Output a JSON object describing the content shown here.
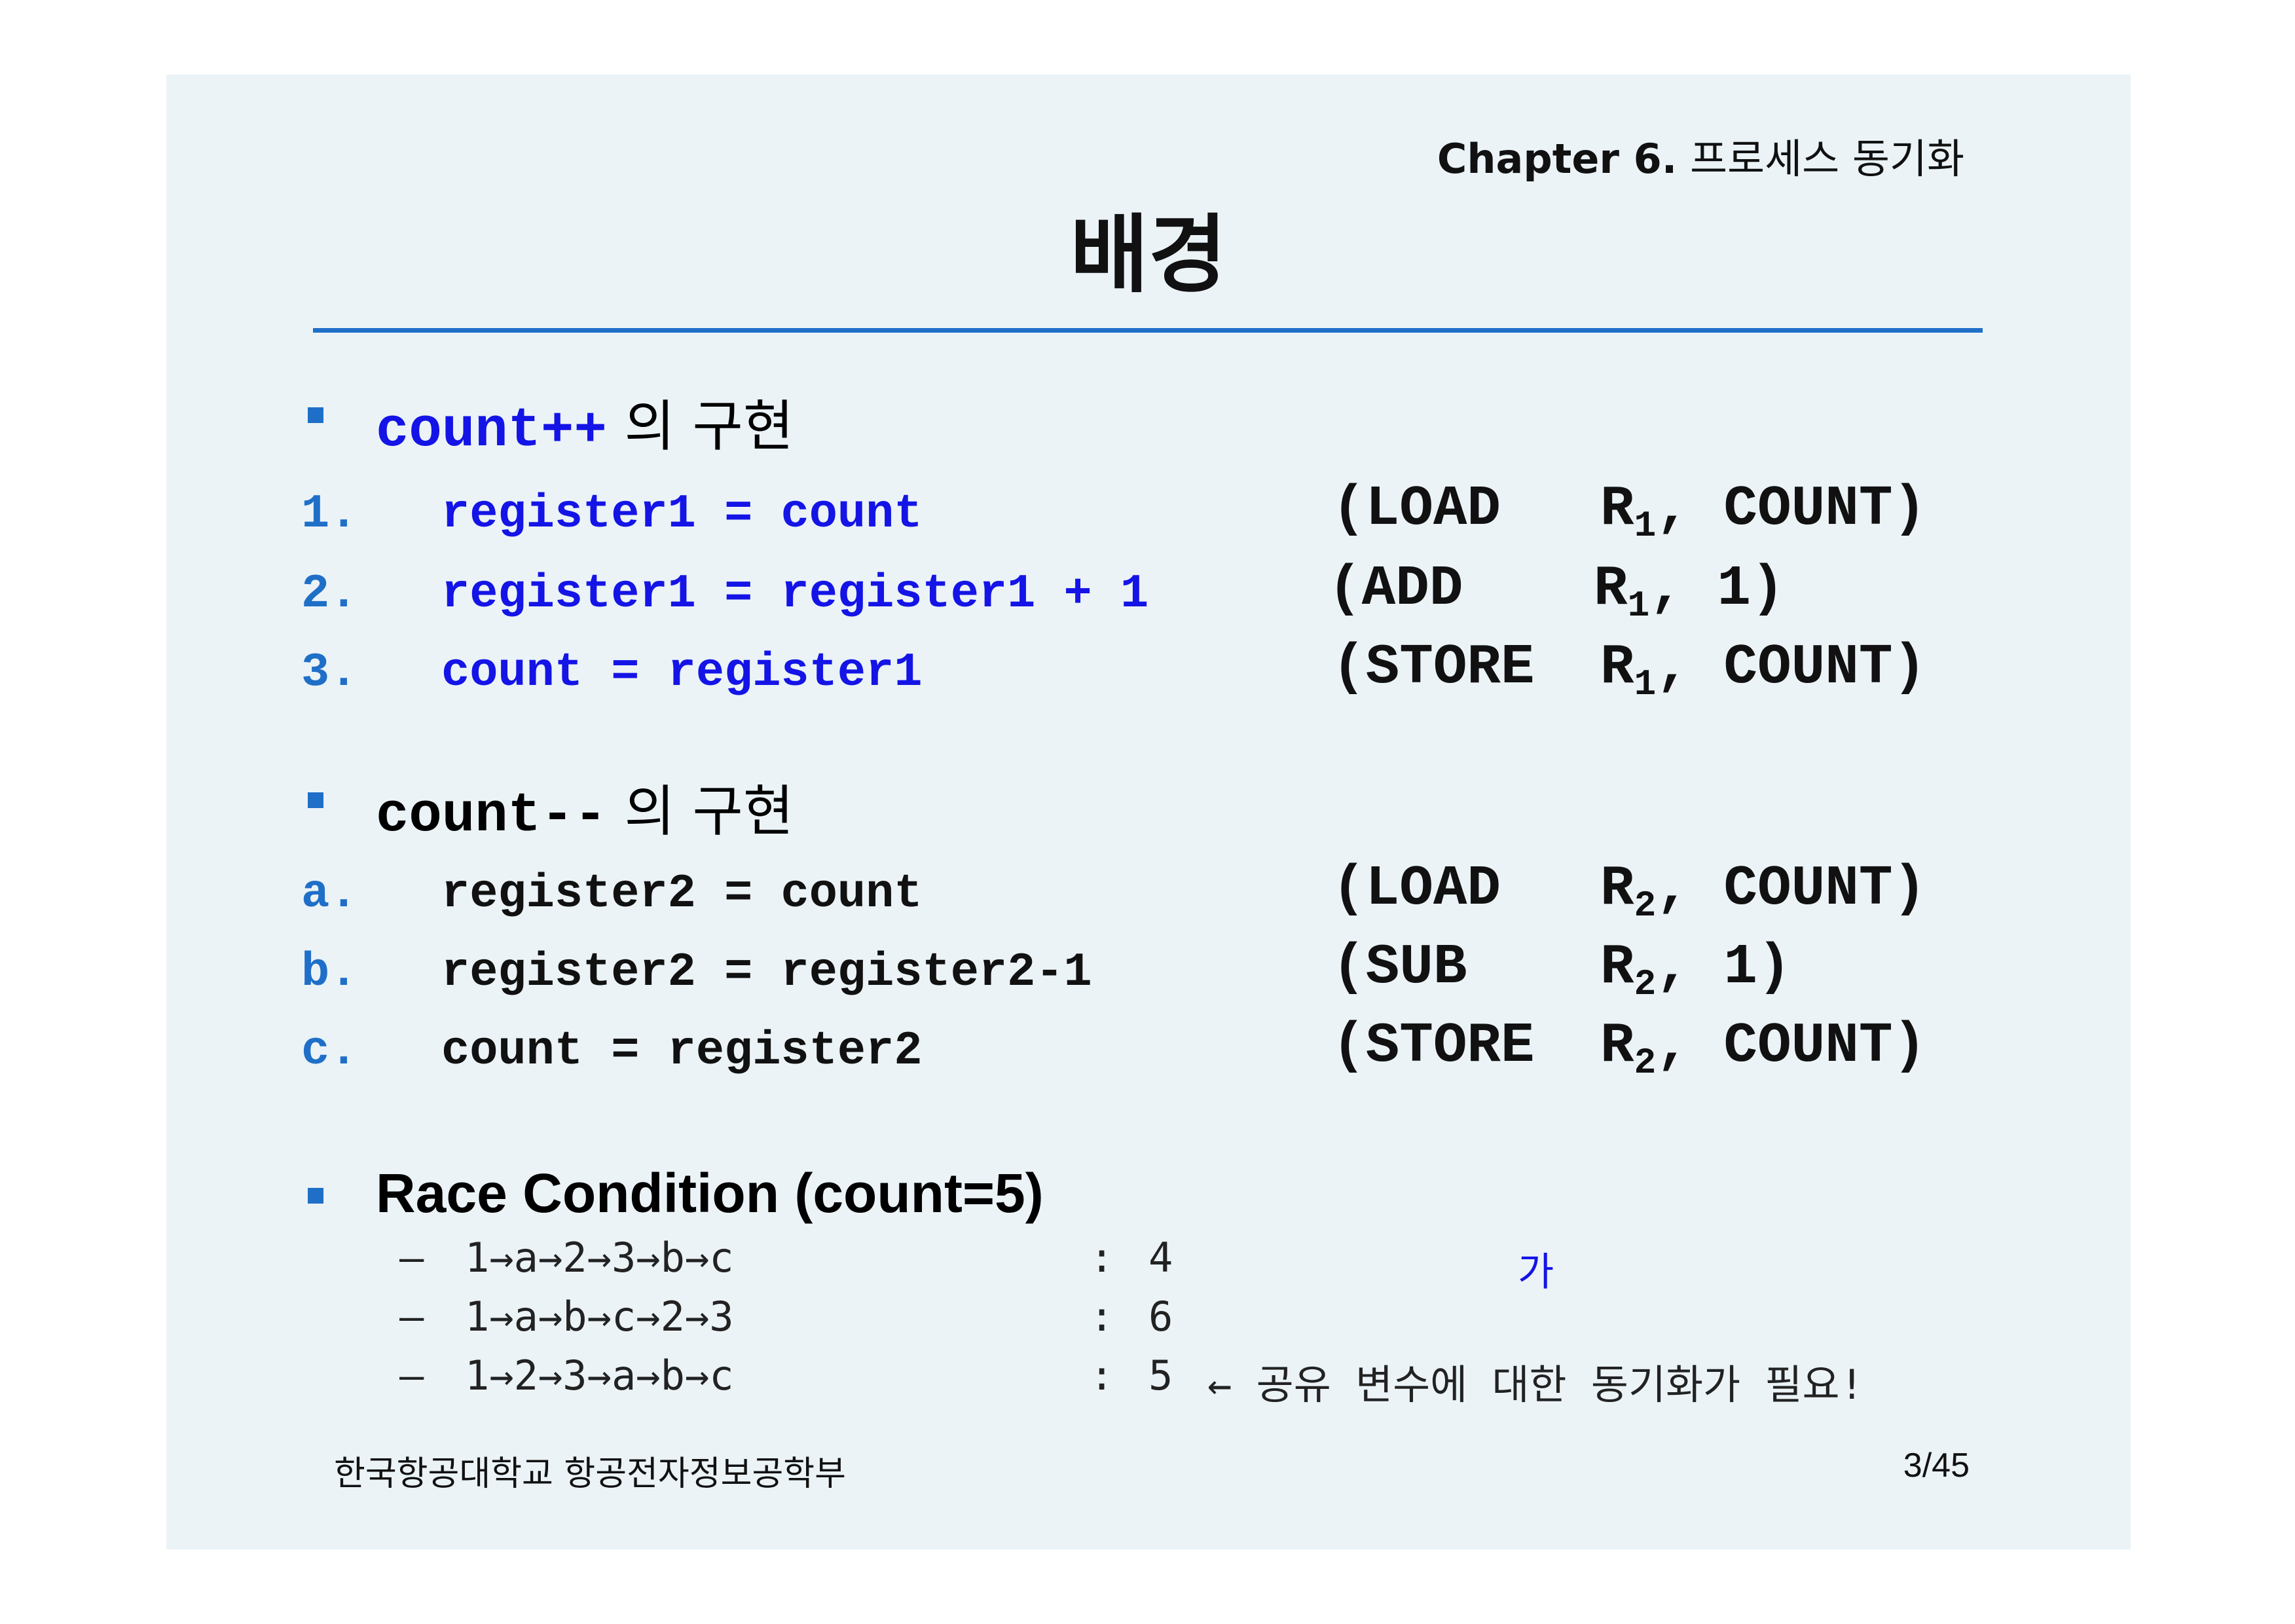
{
  "header": {
    "chapter_label": "Chapter 6.",
    "chapter_title": "프로세스 동기화",
    "slide_title": "배경"
  },
  "section_increment": {
    "code_part": "count++",
    "korean_part": " 의 구현",
    "steps": [
      {
        "num": "1.",
        "code": "register1 = count",
        "op": "(LOAD",
        "reg": "R",
        "sub": "1",
        "arg": ", COUNT)"
      },
      {
        "num": "2.",
        "code": "register1 = register1 + 1",
        "op": "(ADD",
        "reg": "R",
        "sub": "1",
        "arg": ", 1)"
      },
      {
        "num": "3.",
        "code": "count = register1",
        "op": "(STORE",
        "reg": "R",
        "sub": "1",
        "arg": ", COUNT)"
      }
    ]
  },
  "section_decrement": {
    "code_part": "count--",
    "korean_part": " 의 구현",
    "steps": [
      {
        "num": "a.",
        "code": "register2 = count",
        "op": "(LOAD",
        "reg": "R",
        "sub": "2",
        "arg": ", COUNT)"
      },
      {
        "num": "b.",
        "code": "register2 = register2-1",
        "op": "(SUB",
        "reg": "R",
        "sub": "2",
        "arg": ", 1)"
      },
      {
        "num": "c.",
        "code": "count = register2",
        "op": "(STORE",
        "reg": "R",
        "sub": "2",
        "arg": ", COUNT)"
      }
    ]
  },
  "section_race": {
    "heading": "Race Condition (count=5)",
    "blue_note": "가",
    "orders": [
      {
        "dash": "–",
        "sequence": "1→a→2→3→b→c",
        "colon": ":",
        "result": "4",
        "note": ""
      },
      {
        "dash": "–",
        "sequence": "1→a→b→c→2→3",
        "colon": ":",
        "result": "6",
        "note": ""
      },
      {
        "dash": "–",
        "sequence": "1→2→3→a→b→c",
        "colon": ":",
        "result": "5",
        "note": "← 공유 변수에 대한 동기화가 필요!"
      }
    ]
  },
  "footer": {
    "department": "한국항공대학교 항공전자정보공학부",
    "page": "3/45"
  }
}
